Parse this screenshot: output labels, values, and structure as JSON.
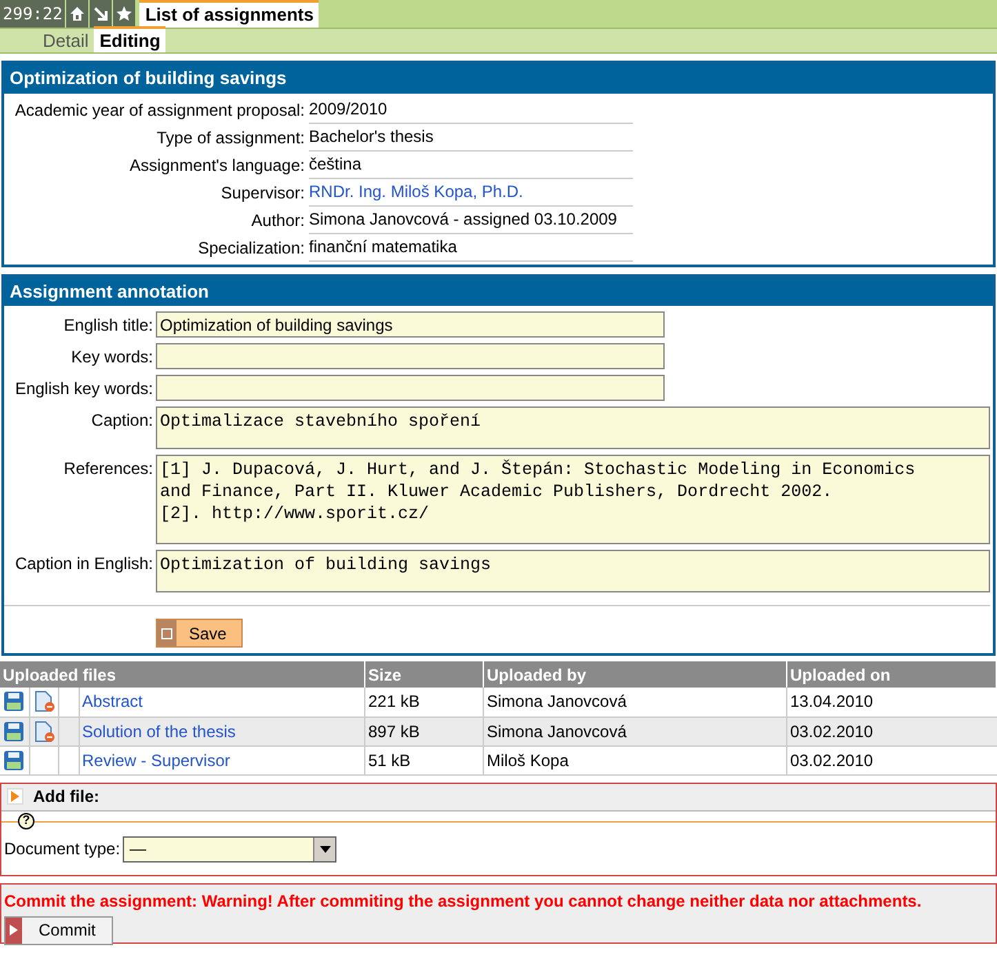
{
  "top_bar": {
    "timer": "299:22",
    "tabs": [
      {
        "label": "List of assignments",
        "selected": true
      }
    ]
  },
  "sub_tabs": [
    {
      "label": "Detail",
      "selected": false
    },
    {
      "label": "Editing",
      "selected": true
    }
  ],
  "assignment": {
    "title": "Optimization of building savings",
    "fields": [
      {
        "label": "Academic year of assignment proposal:",
        "value": "2009/2010",
        "kind": "text"
      },
      {
        "label": "Type of assignment:",
        "value": "Bachelor's thesis",
        "kind": "text"
      },
      {
        "label": "Assignment's language:",
        "value": "čeština",
        "kind": "text"
      },
      {
        "label": "Supervisor:",
        "value": "RNDr. Ing. Miloš Kopa, Ph.D.",
        "kind": "link"
      },
      {
        "label": "Author:",
        "value": "Simona Janovcová - assigned 03.10.2009",
        "kind": "text"
      },
      {
        "label": "Specialization:",
        "value": "finanční matematika",
        "kind": "text"
      }
    ]
  },
  "annotation": {
    "title": "Assignment annotation",
    "fields": [
      {
        "label": "English title:",
        "kind": "input",
        "value": "Optimization of building savings"
      },
      {
        "label": "Key words:",
        "kind": "input"
      },
      {
        "label": "English key words:",
        "kind": "input"
      },
      {
        "label": "Caption:",
        "kind": "textarea",
        "lines": [
          "Optimalizace stavebního spoření"
        ]
      },
      {
        "label": "References:",
        "kind": "textarea",
        "lines": [
          "[1] J. Dupacová, J. Hurt, and J. Štepán: Stochastic Modeling in Economics",
          "and Finance, Part II. Kluwer Academic Publishers, Dordrecht 2002.",
          "[2]. http://www.sporit.cz/"
        ]
      },
      {
        "label": "Caption in English:",
        "kind": "textarea",
        "lines": [
          "Optimization of building savings"
        ]
      }
    ],
    "save_button": "Save"
  },
  "files": {
    "columns": [
      "Uploaded files",
      "Size",
      "Uploaded by",
      "Uploaded on"
    ],
    "rows": [
      {
        "name": "Abstract",
        "size": "221 kB",
        "uploaded_by": "Simona Janovcová",
        "uploaded_on": "13.04.2010",
        "removable": true
      },
      {
        "name": "Solution of the thesis",
        "size": "897 kB",
        "uploaded_by": "Simona Janovcová",
        "uploaded_on": "03.02.2010",
        "removable": true
      },
      {
        "name": "Review - Supervisor",
        "size": "51 kB",
        "uploaded_by": "Miloš Kopa",
        "uploaded_on": "03.02.2010",
        "removable": false
      }
    ]
  },
  "add_file": {
    "title": "Add file:",
    "help_mark": "?",
    "document_type_label": "Document type:",
    "document_type_value": "—"
  },
  "commit": {
    "warning": "Commit the assignment: Warning! After commiting the assignment you cannot change neither data nor attachments.",
    "button": "Commit"
  }
}
